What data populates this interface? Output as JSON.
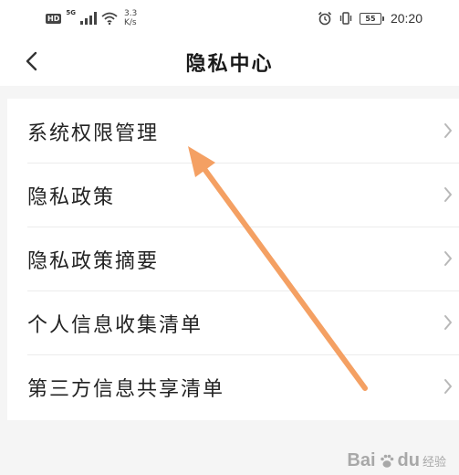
{
  "status_bar": {
    "hd_badge": "HD",
    "network_type": "5G",
    "speed_value": "3.3",
    "speed_unit": "K/s",
    "battery_level": "55",
    "time": "20:20",
    "icons": [
      "signal-icon",
      "wifi-icon",
      "alarm-icon",
      "vibrate-icon",
      "battery-icon"
    ]
  },
  "header": {
    "title": "隐私中心",
    "back_icon": "chevron-left-icon"
  },
  "menu": {
    "items": [
      {
        "label": "系统权限管理"
      },
      {
        "label": "隐私政策"
      },
      {
        "label": "隐私政策摘要"
      },
      {
        "label": "个人信息收集清单"
      },
      {
        "label": "第三方信息共享清单"
      }
    ],
    "chevron_icon": "chevron-right-icon"
  },
  "annotation": {
    "arrow_color": "#f4a063"
  },
  "watermark": {
    "brand": "Bai",
    "brand_suffix": "du",
    "sub": "经验"
  }
}
